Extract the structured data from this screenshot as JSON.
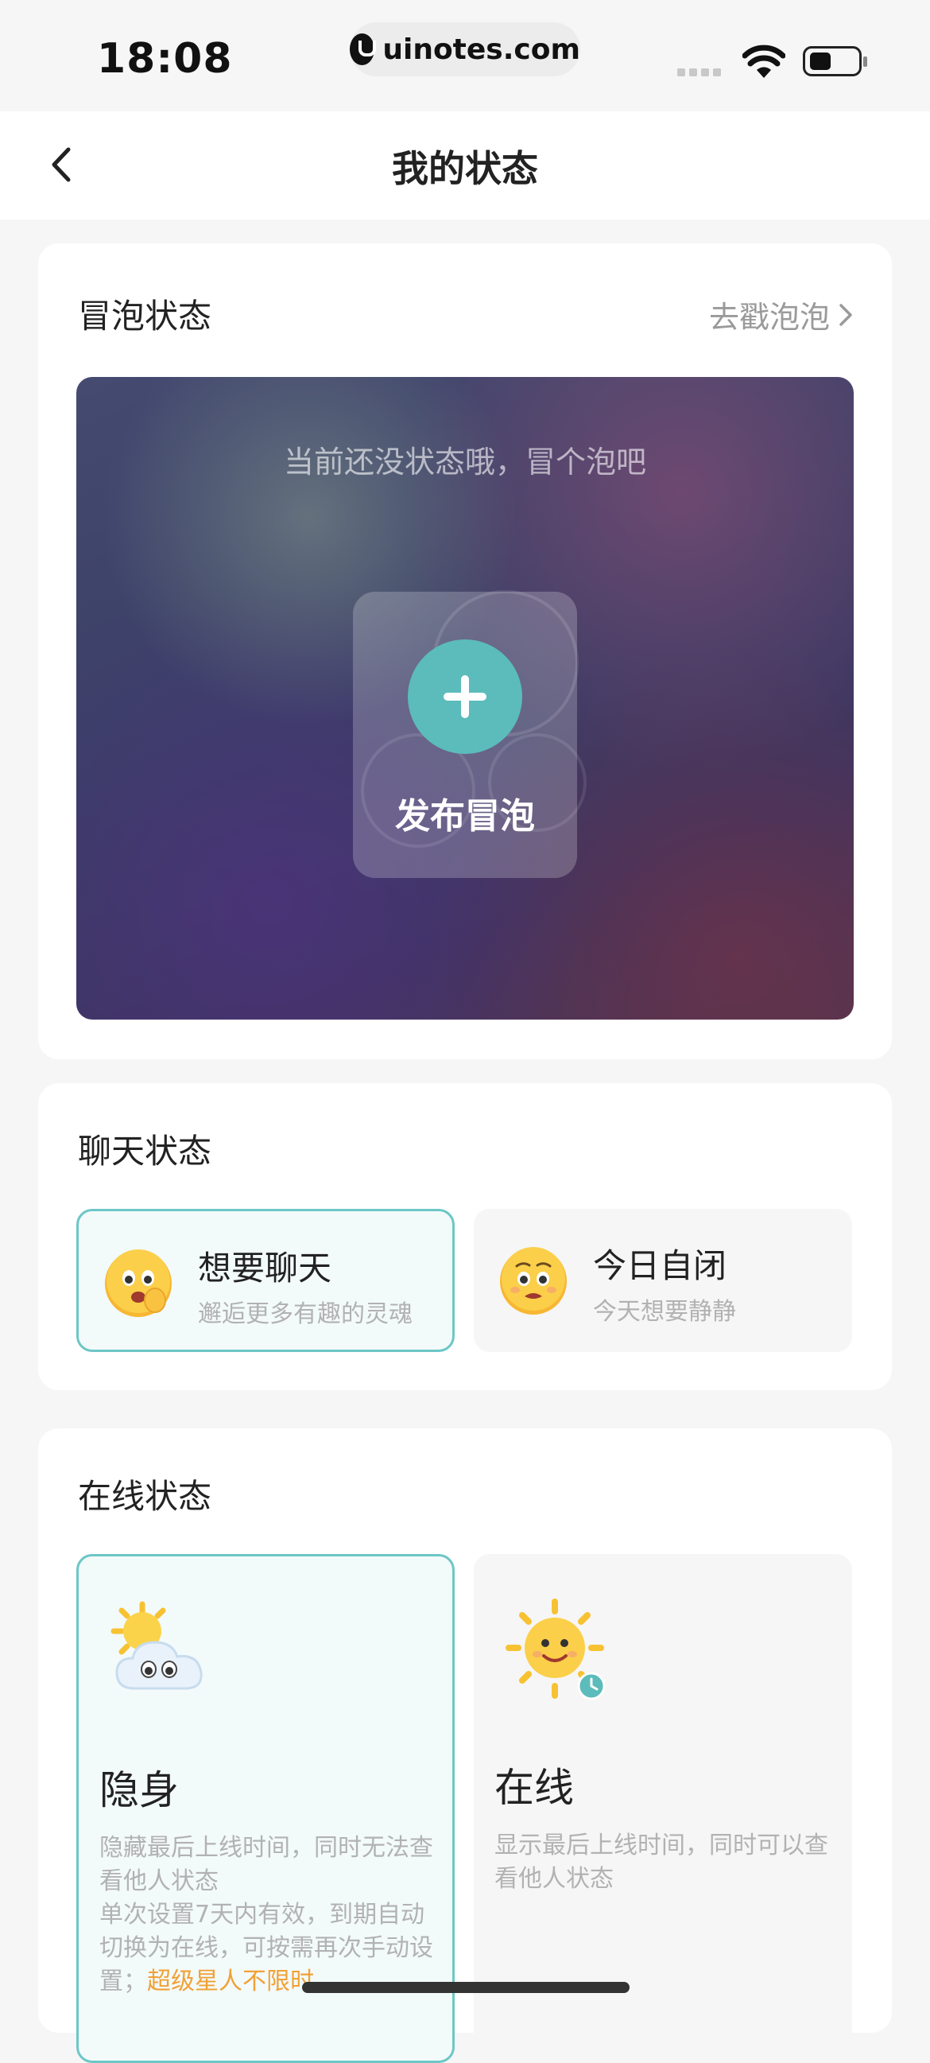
{
  "status_bar": {
    "time": "18:08",
    "url": "uinotes.com",
    "icons": [
      "signal-icon",
      "wifi-icon",
      "battery-icon"
    ]
  },
  "nav": {
    "title": "我的状态",
    "back_icon": "chevron-left-icon"
  },
  "bubble_section": {
    "title": "冒泡状态",
    "link_label": "去戳泡泡",
    "empty_hint": "当前还没状态哦，冒个泡吧",
    "publish_label": "发布冒泡"
  },
  "chat_section": {
    "title": "聊天状态",
    "options": [
      {
        "title": "想要聊天",
        "subtitle": "邂逅更多有趣的灵魂",
        "icon": "chatty-face-icon",
        "selected": true
      },
      {
        "title": "今日自闭",
        "subtitle": "今天想要静静",
        "icon": "pleading-face-icon",
        "selected": false
      }
    ]
  },
  "online_section": {
    "title": "在线状态",
    "options": [
      {
        "title": "隐身",
        "desc_line1": "隐藏最后上线时间，同时无法查看他人状态",
        "desc_line2": "单次设置7天内有效，到期自动切换为在线，可按需再次手动设置；",
        "vip_text": "超级星人不限时",
        "icon": "sun-behind-cloud-icon",
        "selected": true
      },
      {
        "title": "在线",
        "desc_line1": "显示最后上线时间，同时可以查看他人状态",
        "icon": "sun-clock-icon",
        "selected": false
      }
    ]
  },
  "colors": {
    "accent": "#5bbcbb",
    "vip": "#f1a135",
    "background": "#f6f6f6"
  }
}
